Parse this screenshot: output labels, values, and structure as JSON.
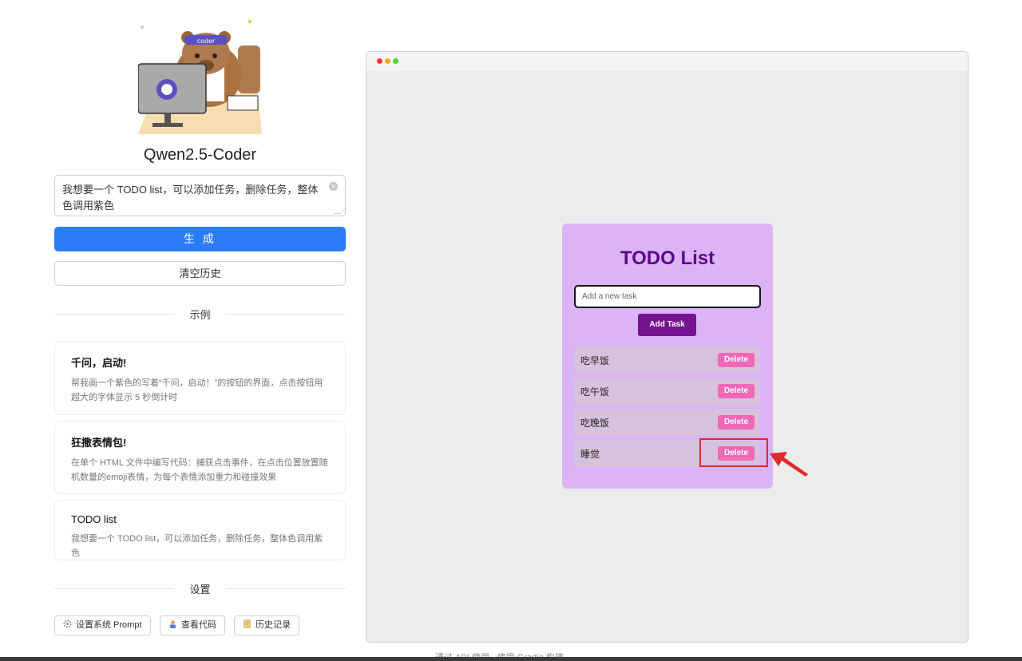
{
  "sidebar": {
    "title": "Qwen2.5-Coder",
    "prompt": {
      "value": "我想要一个 TODO list，可以添加任务，删除任务，整体色调用紫色",
      "clear_icon": "close-circle-icon"
    },
    "generate_label": "生 成",
    "clear_history_label": "清空历史",
    "examples_heading": "示例",
    "examples": [
      {
        "title": "千问，启动!",
        "desc": "帮我画一个紫色的写着“千问，启动！”的按钮的界面，点击按钮用超大的字体显示 5 秒倒计时"
      },
      {
        "title": "狂撒表情包!",
        "desc": "在单个 HTML 文件中编写代码：捕获点击事件，在点击位置放置随机数量的emoji表情，为每个表情添加重力和碰撞效果"
      },
      {
        "title": "TODO list",
        "desc": "我想要一个 TODO list，可以添加任务，删除任务，整体色调用紫色"
      }
    ],
    "settings_heading": "设置",
    "settings_buttons": [
      {
        "label": "设置系统 Prompt",
        "icon": "gear-icon"
      },
      {
        "label": "查看代码",
        "icon": "person-icon"
      },
      {
        "label": "历史记录",
        "icon": "scroll-icon"
      }
    ]
  },
  "preview": {
    "window_dots": [
      "#ff3b30",
      "#f5a623",
      "#4cd137"
    ],
    "todo": {
      "title": "TODO List",
      "input_placeholder": "Add a new task",
      "add_label": "Add Task",
      "items": [
        {
          "text": "吃早饭",
          "delete_label": "Delete"
        },
        {
          "text": "吃午饭",
          "delete_label": "Delete"
        },
        {
          "text": "吃晚饭",
          "delete_label": "Delete"
        },
        {
          "text": "睡觉",
          "delete_label": "Delete"
        }
      ]
    }
  },
  "footer": {
    "text": "通过 API 使用 · 使用 Gradio 构建"
  },
  "colors": {
    "primary": "#2b7cf9",
    "todo_card": "#dcb3f6",
    "todo_title": "#5a0886",
    "add_button": "#77128f",
    "delete_button": "#f168b8",
    "highlight": "#e02a2a"
  }
}
